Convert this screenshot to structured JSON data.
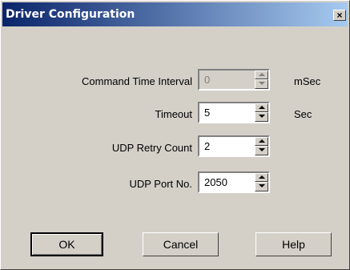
{
  "window": {
    "title": "Driver Configuration",
    "close_glyph": "×"
  },
  "fields": [
    {
      "label": "Command Time Interval",
      "value": "0",
      "unit": "mSec",
      "enabled": false
    },
    {
      "label": "Timeout",
      "value": "5",
      "unit": "Sec",
      "enabled": true
    },
    {
      "label": "UDP Retry Count",
      "value": "2",
      "unit": "",
      "enabled": true
    },
    {
      "label": "UDP Port No.",
      "value": "2050",
      "unit": "",
      "enabled": true
    }
  ],
  "buttons": {
    "ok": "OK",
    "cancel": "Cancel",
    "help": "Help"
  },
  "colors": {
    "titlebar_start": "#0a246a",
    "titlebar_end": "#a6caf0",
    "face": "#d4d0c8"
  }
}
